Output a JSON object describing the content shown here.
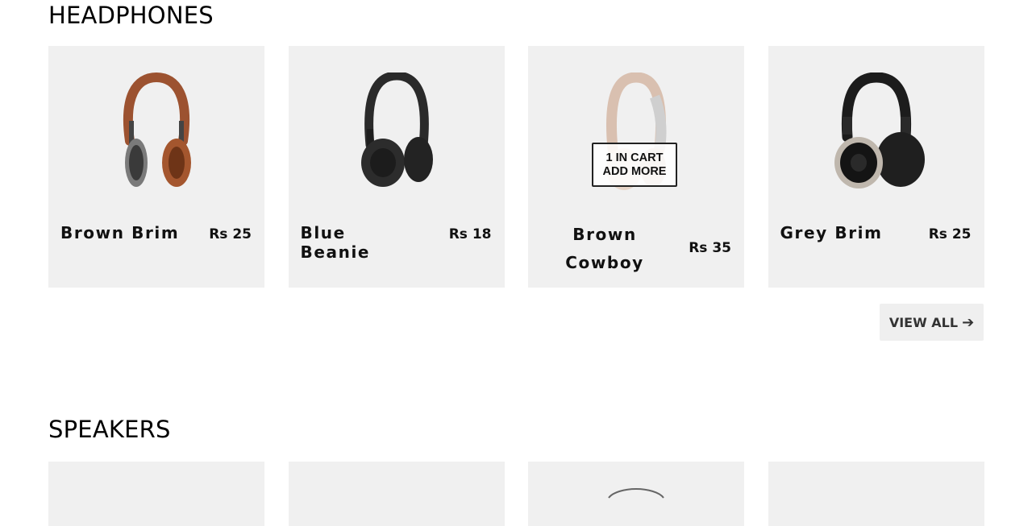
{
  "sections": {
    "headphones": {
      "title": "HEADPHONES",
      "products": [
        {
          "name": "Brown Brim",
          "price": "Rs 25",
          "image": "headphones-brown-icon"
        },
        {
          "name": "Blue Beanie",
          "price": "Rs 18",
          "image": "headphones-black-icon"
        },
        {
          "name": "Brown Cowboy",
          "price": "Rs 35",
          "image": "headphones-beige-icon",
          "cart_line1": "1 IN CART",
          "cart_line2": "ADD MORE"
        },
        {
          "name": "Grey Brim",
          "price": "Rs 25",
          "image": "headphones-grey-icon"
        }
      ],
      "view_all_label": "VIEW ALL",
      "view_all_icon": "arrow-right-icon"
    },
    "speakers": {
      "title": "SPEAKERS"
    }
  },
  "colors": {
    "card_bg": "#f0f0f0",
    "button_bg": "#efefef"
  }
}
